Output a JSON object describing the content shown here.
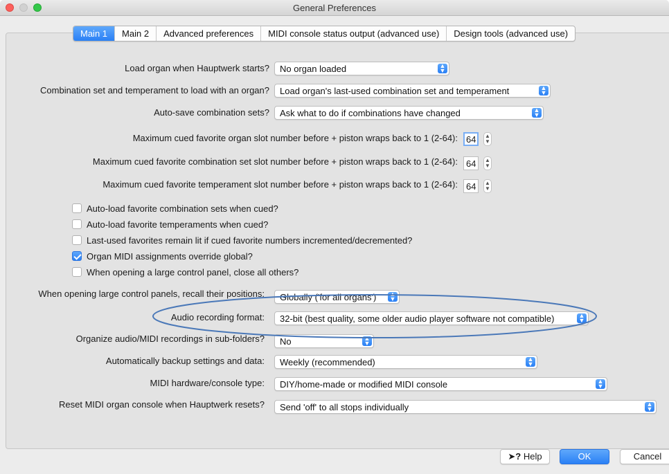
{
  "window": {
    "title": "General Preferences"
  },
  "tabs": [
    {
      "label": "Main 1",
      "active": true
    },
    {
      "label": "Main 2",
      "active": false
    },
    {
      "label": "Advanced preferences",
      "active": false
    },
    {
      "label": "MIDI console status output (advanced use)",
      "active": false
    },
    {
      "label": "Design tools (advanced use)",
      "active": false
    }
  ],
  "settings": {
    "load_organ": {
      "label": "Load organ when Hauptwerk starts?",
      "value": "No organ loaded"
    },
    "combination_set": {
      "label": "Combination set and temperament to load with an organ?",
      "value": "Load organ's last-used combination set and temperament"
    },
    "auto_save": {
      "label": "Auto-save combination sets?",
      "value": "Ask what to do if combinations have changed"
    },
    "max_organ_slot": {
      "label": "Maximum cued favorite organ slot number before + piston wraps back to 1 (2-64):",
      "value": "64"
    },
    "max_combination_slot": {
      "label": "Maximum cued favorite combination set slot number before + piston wraps back to 1 (2-64):",
      "value": "64"
    },
    "max_temperament_slot": {
      "label": "Maximum cued favorite temperament slot number before + piston wraps back to 1 (2-64):",
      "value": "64"
    },
    "checkboxes": [
      {
        "label": "Auto-load favorite combination sets when cued?",
        "checked": false
      },
      {
        "label": "Auto-load favorite temperaments when cued?",
        "checked": false
      },
      {
        "label": "Last-used favorites remain lit if cued favorite numbers incremented/decremented?",
        "checked": false
      },
      {
        "label": "Organ MIDI assignments override global?",
        "checked": true
      },
      {
        "label": "When opening a large control panel, close all others?",
        "checked": false
      }
    ],
    "recall_positions": {
      "label": "When opening large control panels, recall their positions:",
      "value": "Globally ('for all organs')"
    },
    "audio_format": {
      "label": "Audio recording format:",
      "value": "32-bit (best quality, some older audio player software not compatible)"
    },
    "subfolders": {
      "label": "Organize audio/MIDI recordings in sub-folders?",
      "value": "No"
    },
    "backup": {
      "label": "Automatically backup settings and data:",
      "value": "Weekly (recommended)"
    },
    "midi_hardware": {
      "label": "MIDI hardware/console type:",
      "value": "DIY/home-made or modified MIDI console"
    },
    "reset_console": {
      "label": "Reset MIDI organ console when Hauptwerk resets?",
      "value": "Send 'off' to all stops individually"
    }
  },
  "buttons": {
    "help": "Help",
    "ok": "OK",
    "cancel": "Cancel"
  },
  "colors": {
    "accent": "#2a80f5",
    "annotation_ellipse": "#4a78b8"
  }
}
